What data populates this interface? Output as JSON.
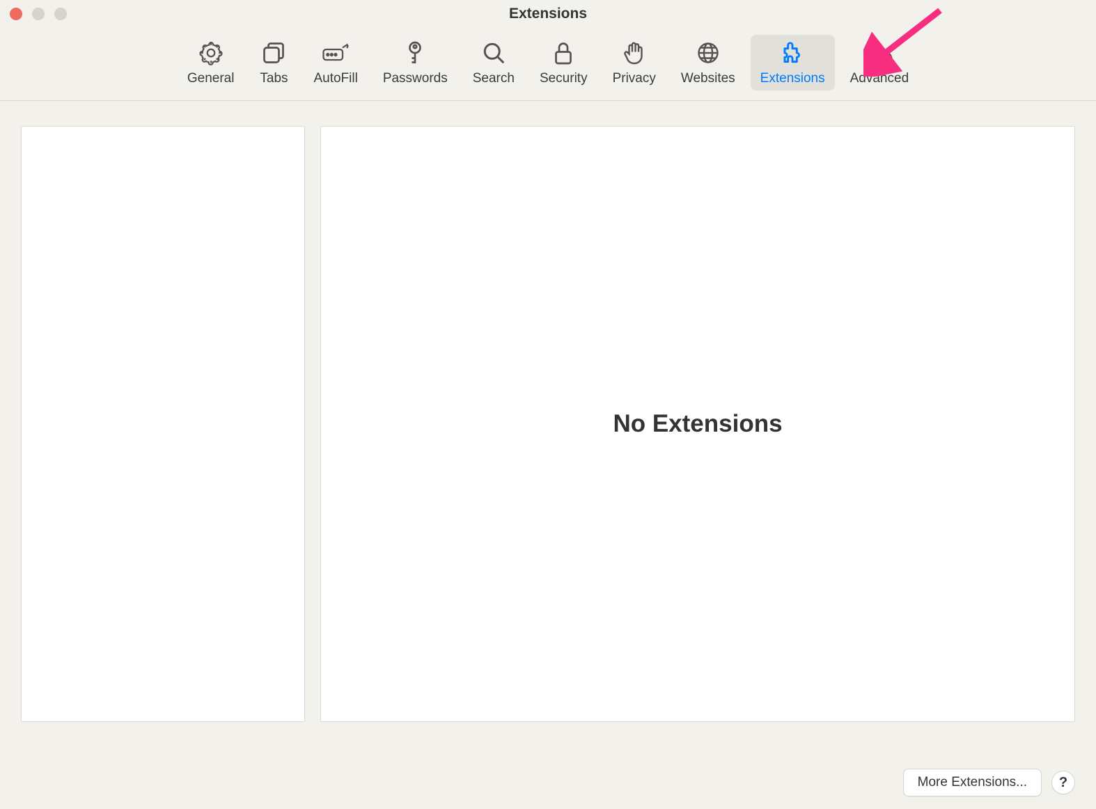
{
  "window": {
    "title": "Extensions"
  },
  "toolbar": {
    "items": [
      {
        "id": "general",
        "label": "General",
        "icon": "gear-icon"
      },
      {
        "id": "tabs",
        "label": "Tabs",
        "icon": "tabs-icon"
      },
      {
        "id": "autofill",
        "label": "AutoFill",
        "icon": "autofill-icon"
      },
      {
        "id": "passwords",
        "label": "Passwords",
        "icon": "key-icon"
      },
      {
        "id": "search",
        "label": "Search",
        "icon": "search-icon"
      },
      {
        "id": "security",
        "label": "Security",
        "icon": "lock-icon"
      },
      {
        "id": "privacy",
        "label": "Privacy",
        "icon": "hand-icon"
      },
      {
        "id": "websites",
        "label": "Websites",
        "icon": "globe-icon"
      },
      {
        "id": "extensions",
        "label": "Extensions",
        "icon": "puzzle-icon",
        "selected": true
      },
      {
        "id": "advanced",
        "label": "Advanced",
        "icon": "gears-icon"
      }
    ]
  },
  "main": {
    "empty_message": "No Extensions"
  },
  "footer": {
    "more_button": "More Extensions...",
    "help_button": "?"
  },
  "annotation": {
    "arrow_color": "#f72e7f"
  }
}
